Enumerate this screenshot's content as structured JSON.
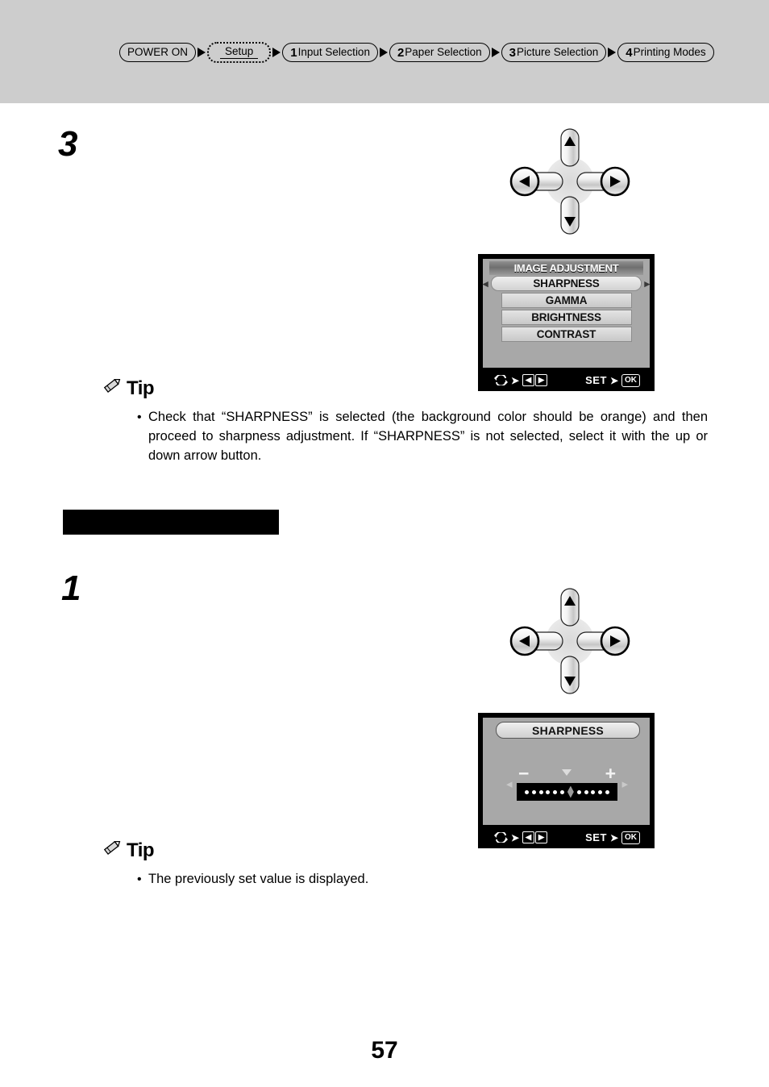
{
  "flow": {
    "steps": [
      {
        "label": "POWER ON",
        "num": "",
        "style": "solid"
      },
      {
        "label": "Setup",
        "num": "",
        "style": "dotted"
      },
      {
        "label": "Input Selection",
        "num": "1",
        "style": "solid"
      },
      {
        "label": "Paper Selection",
        "num": "2",
        "style": "solid"
      },
      {
        "label": "Picture Selection",
        "num": "3",
        "style": "solid"
      },
      {
        "label": "Printing Modes",
        "num": "4",
        "style": "solid"
      }
    ]
  },
  "sections": [
    {
      "step_number": "3",
      "lcd": {
        "title": "IMAGE ADJUSTMENT",
        "items": [
          {
            "label": "SHARPNESS",
            "selected": true
          },
          {
            "label": "GAMMA",
            "selected": false
          },
          {
            "label": "BRIGHTNESS",
            "selected": false
          },
          {
            "label": "CONTRAST",
            "selected": false
          }
        ]
      },
      "tip": {
        "heading": "Tip",
        "text": "Check that “SHARPNESS” is selected (the background color should be orange) and then proceed to sharpness adjustment. If “SHARPNESS” is not selected, select it with the up or down arrow button."
      }
    },
    {
      "step_number": "1",
      "lcd": {
        "title": "SHARPNESS",
        "minus_sign": "−",
        "plus_sign": "+",
        "scale_total_dots": 11,
        "marker_index": 6
      },
      "tip": {
        "heading": "Tip",
        "text": "The previously set value is displayed."
      }
    }
  ],
  "lcd_hint": {
    "cycle_icon": "cycle-icon",
    "arrow": "→",
    "left_key": "◀",
    "right_key": "▶",
    "set_label": "SET",
    "ok_key": "OK"
  },
  "bullet": "•",
  "page_number": "57",
  "colors": {
    "header_band": "#cdcdcd",
    "lcd_bezel": "#000000",
    "lcd_screen": "#a8a8a8",
    "text": "#000000"
  }
}
